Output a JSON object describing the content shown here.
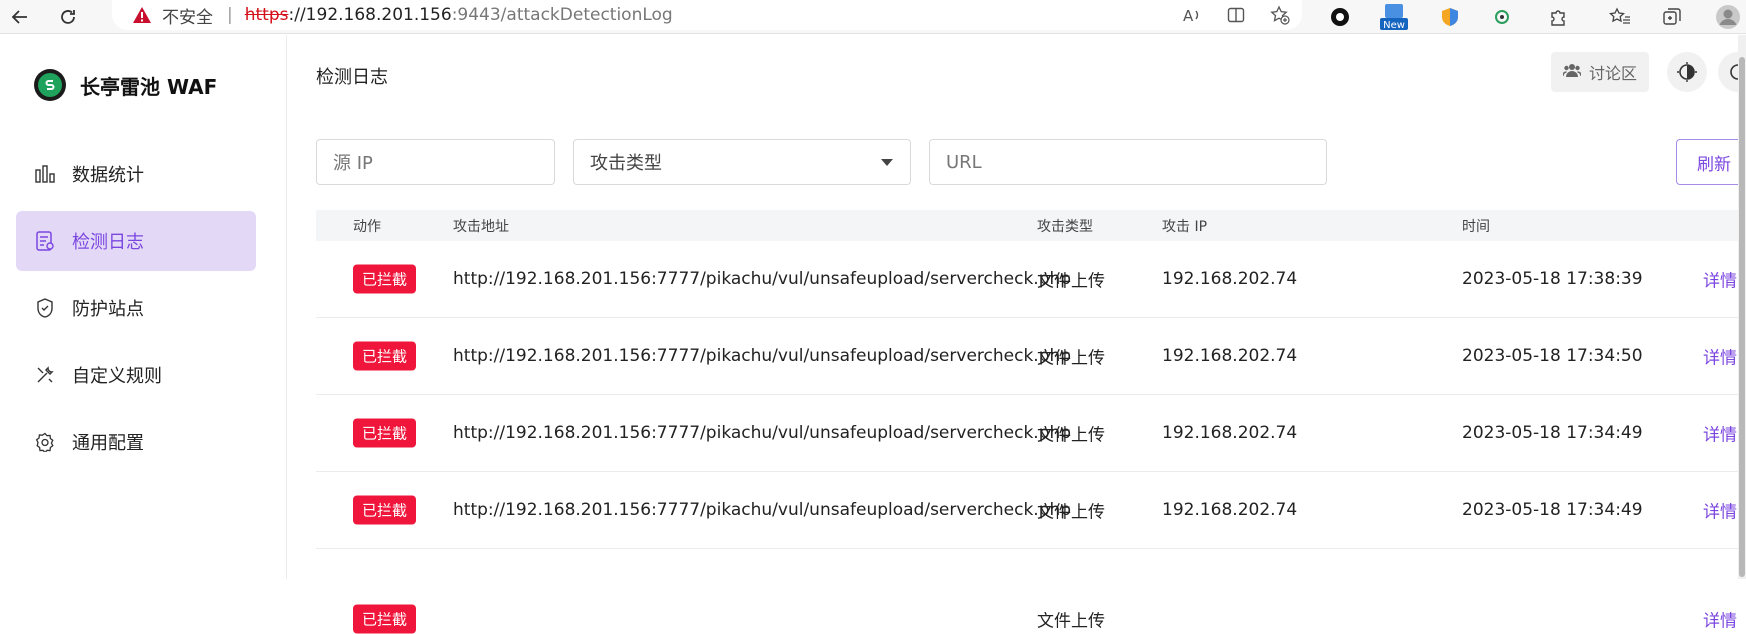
{
  "browser": {
    "security_warning": "不安全",
    "url_scheme": "https",
    "url_host": "://192.168.201.156",
    "url_path": ":9443/attackDetectionLog",
    "new_badge": "New"
  },
  "sidebar": {
    "brand": "长亭雷池 WAF",
    "items": [
      {
        "label": "数据统计",
        "icon": "bar-chart-icon"
      },
      {
        "label": "检测日志",
        "icon": "log-icon",
        "active": true
      },
      {
        "label": "防护站点",
        "icon": "shield-icon"
      },
      {
        "label": "自定义规则",
        "icon": "tools-icon"
      },
      {
        "label": "通用配置",
        "icon": "gear-icon"
      }
    ]
  },
  "header": {
    "title": "检测日志",
    "forum_label": "讨论区"
  },
  "filters": {
    "source_ip_placeholder": "源 IP",
    "attack_type_placeholder": "攻击类型",
    "url_placeholder": "URL",
    "refresh_label": "刷新"
  },
  "table": {
    "columns": [
      "动作",
      "攻击地址",
      "攻击类型",
      "攻击 IP",
      "时间"
    ],
    "rows": [
      {
        "action": "已拦截",
        "url": "http://192.168.201.156:7777/pikachu/vul/unsafeupload/servercheck.php",
        "type": "文件上传",
        "ip": "192.168.202.74",
        "time": "2023-05-18 17:38:39",
        "detail": "详情"
      },
      {
        "action": "已拦截",
        "url": "http://192.168.201.156:7777/pikachu/vul/unsafeupload/servercheck.php",
        "type": "文件上传",
        "ip": "192.168.202.74",
        "time": "2023-05-18 17:34:50",
        "detail": "详情"
      },
      {
        "action": "已拦截",
        "url": "http://192.168.201.156:7777/pikachu/vul/unsafeupload/servercheck.php",
        "type": "文件上传",
        "ip": "192.168.202.74",
        "time": "2023-05-18 17:34:49",
        "detail": "详情"
      },
      {
        "action": "已拦截",
        "url": "http://192.168.201.156:7777/pikachu/vul/unsafeupload/servercheck.php",
        "type": "文件上传",
        "ip": "192.168.202.74",
        "time": "2023-05-18 17:34:49",
        "detail": "详情"
      },
      {
        "action": "已拦截",
        "url": "",
        "type": "文件上传",
        "ip": "",
        "time": "",
        "detail": "详情"
      }
    ]
  },
  "colors": {
    "accent": "#7b46e0",
    "active_bg": "#e3d9f7",
    "blocked_badge": "#f0163b"
  }
}
